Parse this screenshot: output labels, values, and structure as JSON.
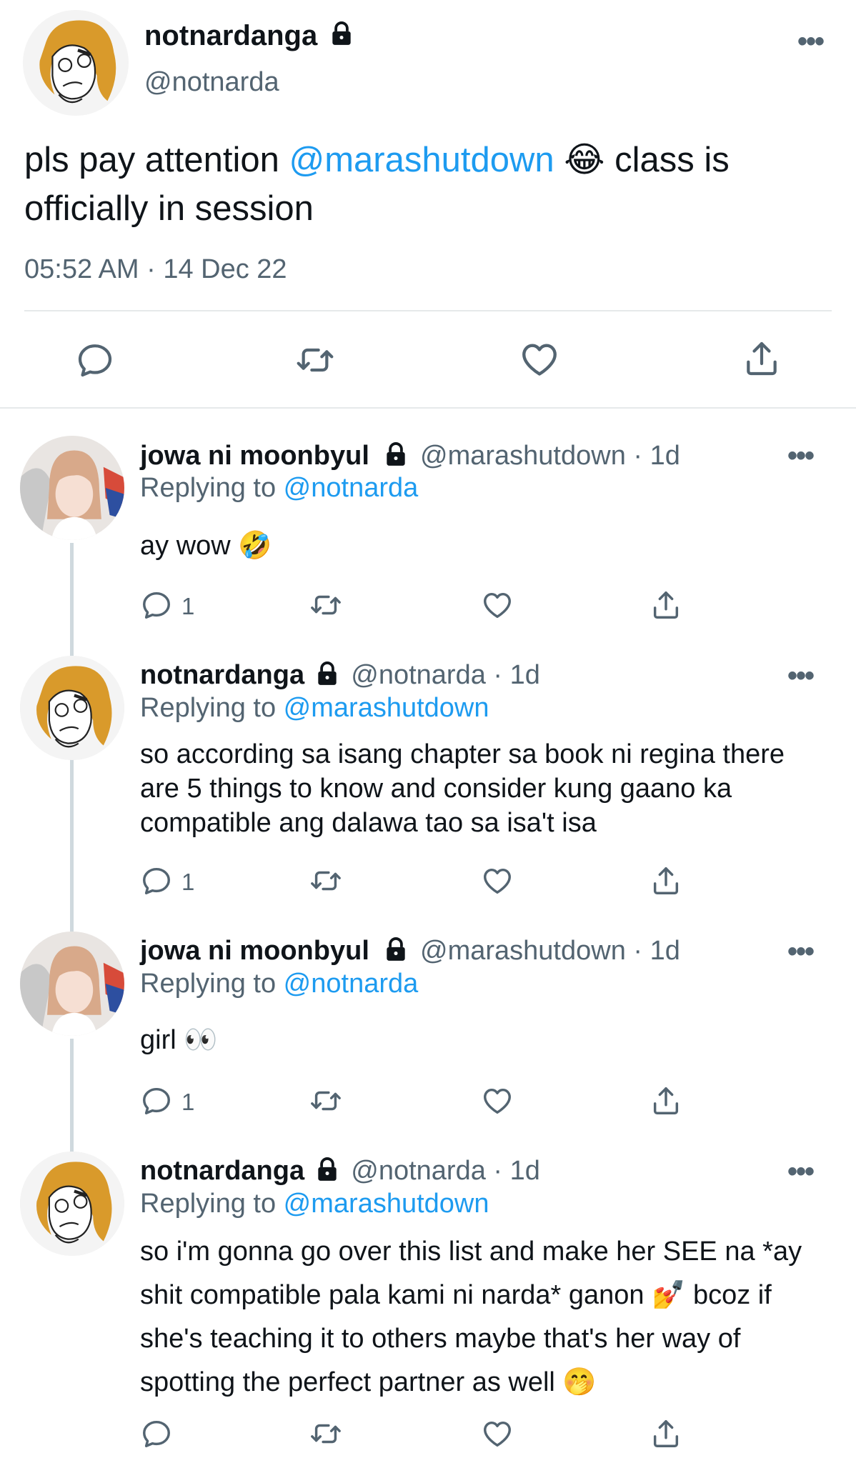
{
  "main_tweet": {
    "name": "notnardanga",
    "handle": "@notnarda",
    "text_before": "pls pay attention ",
    "mention": "@marashutdown",
    "emoji": "😂",
    "text_after": " class is officially in session",
    "timestamp": "05:52 AM · 14 Dec 22",
    "more": "•••"
  },
  "replies": [
    {
      "name": "jowa ni moonbyul",
      "handle": "@marashutdown",
      "time": "· 1d",
      "replying_label": "Replying to ",
      "replying_to": "@notnarda",
      "text": "ay wow 🤣",
      "reply_count": "1",
      "more": "•••"
    },
    {
      "name": "notnardanga",
      "handle": "@notnarda",
      "time": "· 1d",
      "replying_label": "Replying to ",
      "replying_to": "@marashutdown",
      "text": "so according sa isang chapter sa book ni regina there are 5 things to know and consider kung gaano ka compatible ang dalawa tao sa isa't isa",
      "reply_count": "1",
      "more": "•••"
    },
    {
      "name": "jowa ni moonbyul",
      "handle": "@marashutdown",
      "time": "· 1d",
      "replying_label": "Replying to ",
      "replying_to": "@notnarda",
      "text": "girl 👀",
      "reply_count": "1",
      "more": "•••"
    },
    {
      "name": "notnardanga",
      "handle": "@notnarda",
      "time": "· 1d",
      "replying_label": "Replying to ",
      "replying_to": "@marashutdown",
      "text": "so i'm gonna go over this list and make her SEE na *ay shit compatible pala kami ni narda* ganon 💅 bcoz if she's teaching it to others maybe that's her way of spotting the perfect partner as well 🤭",
      "reply_count": "",
      "more": "•••"
    }
  ],
  "colors": {
    "accent": "#1d9bf0",
    "secondary": "#536471",
    "divider": "#e6e9ea",
    "thread_line": "#cfd9de"
  },
  "icons": [
    "reply-icon",
    "retweet-icon",
    "like-icon",
    "share-icon",
    "lock-icon",
    "more-icon"
  ]
}
